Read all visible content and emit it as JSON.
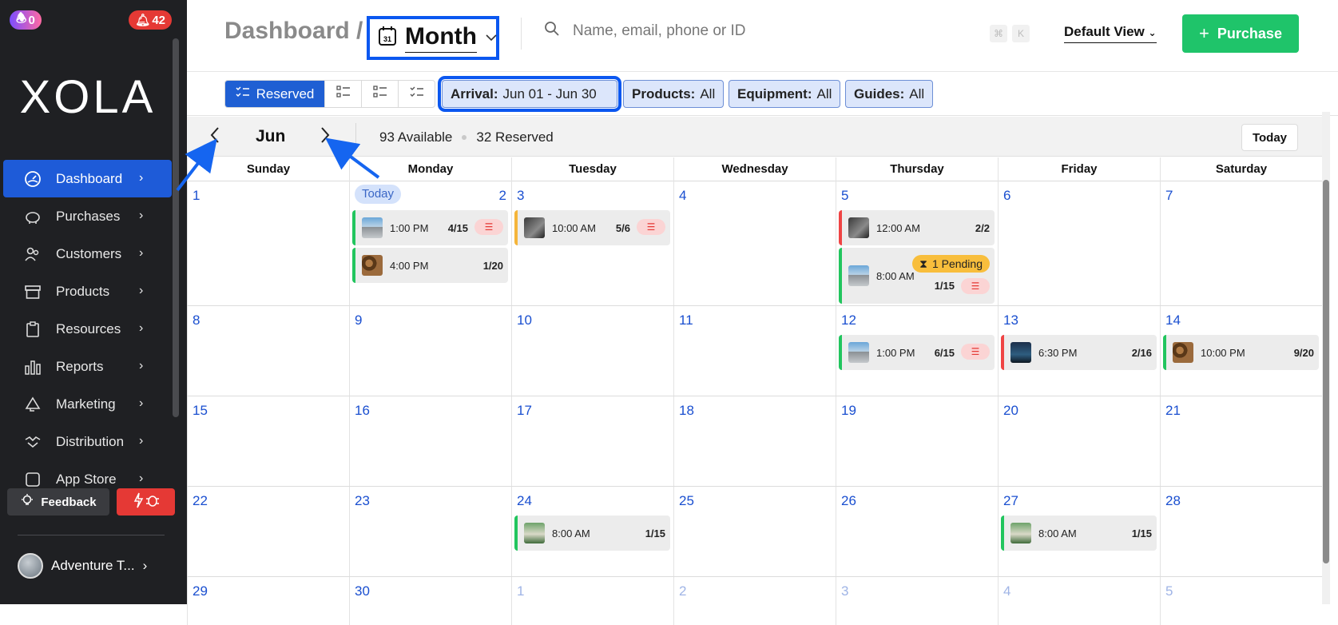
{
  "sidebar": {
    "gift_badge": "0",
    "alert_badge": "42",
    "logo": "XOLA",
    "items": [
      {
        "label": "Dashboard",
        "icon": "dashboard-icon",
        "active": true
      },
      {
        "label": "Purchases",
        "icon": "piggy-bank-icon"
      },
      {
        "label": "Customers",
        "icon": "users-icon"
      },
      {
        "label": "Products",
        "icon": "box-icon"
      },
      {
        "label": "Resources",
        "icon": "clipboard-icon"
      },
      {
        "label": "Reports",
        "icon": "bar-chart-icon"
      },
      {
        "label": "Marketing",
        "icon": "megaphone-icon"
      },
      {
        "label": "Distribution",
        "icon": "handshake-icon"
      },
      {
        "label": "App Store",
        "icon": "app-store-icon"
      }
    ],
    "feedback_label": "Feedback",
    "account_name": "Adventure T..."
  },
  "header": {
    "breadcrumb": "Dashboard /",
    "view_label": "Month",
    "search_placeholder": "Name, email, phone or ID",
    "shortcut_cmd": "⌘",
    "shortcut_key": "K",
    "default_view": "Default View",
    "purchase_label": "Purchase"
  },
  "filters": {
    "reserved_label": "Reserved",
    "arrival_key": "Arrival:",
    "arrival_value": "Jun 01 - Jun 30",
    "products_key": "Products:",
    "products_value": "All",
    "equipment_key": "Equipment:",
    "equipment_value": "All",
    "guides_key": "Guides:",
    "guides_value": "All"
  },
  "calendar_nav": {
    "month": "Jun",
    "available": "93 Available",
    "reserved": "32 Reserved",
    "today_label": "Today"
  },
  "weekdays": [
    "Sunday",
    "Monday",
    "Tuesday",
    "Wednesday",
    "Thursday",
    "Friday",
    "Saturday"
  ],
  "weeks": [
    [
      "1",
      "2",
      "3",
      "4",
      "5",
      "6",
      "7"
    ],
    [
      "8",
      "9",
      "10",
      "11",
      "12",
      "13",
      "14"
    ],
    [
      "15",
      "16",
      "17",
      "18",
      "19",
      "20",
      "21"
    ],
    [
      "22",
      "23",
      "24",
      "25",
      "26",
      "27",
      "28"
    ],
    [
      "29",
      "30",
      "1",
      "2",
      "3",
      "4",
      "5"
    ]
  ],
  "today_tag": "Today",
  "events": {
    "mon2_a": {
      "time": "1:00 PM",
      "cap": "4/15"
    },
    "mon2_b": {
      "time": "4:00 PM",
      "cap": "1/20"
    },
    "tue3_a": {
      "time": "10:00 AM",
      "cap": "5/6"
    },
    "thu5_a": {
      "time": "12:00 AM",
      "cap": "2/2"
    },
    "thu5_b": {
      "time": "8:00 AM",
      "cap": "1/15",
      "pending": "1 Pending"
    },
    "thu12": {
      "time": "1:00 PM",
      "cap": "6/15"
    },
    "fri13": {
      "time": "6:30 PM",
      "cap": "2/16"
    },
    "sat14": {
      "time": "10:00 PM",
      "cap": "9/20"
    },
    "tue24": {
      "time": "8:00 AM",
      "cap": "1/15"
    },
    "fri27": {
      "time": "8:00 AM",
      "cap": "1/15"
    }
  },
  "colors": {
    "accent_blue": "#1e5bd8",
    "purchase_green": "#1fc46a",
    "highlight_outline": "#0b57f0",
    "event_green": "#22c55e",
    "event_amber": "#f5b53a",
    "event_red": "#ef4444"
  }
}
